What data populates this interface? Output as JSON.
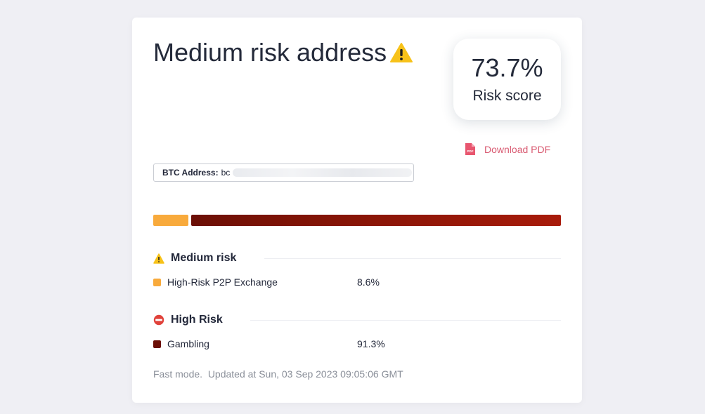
{
  "header": {
    "title": "Medium risk address",
    "title_icon": "warning-icon"
  },
  "score": {
    "value": "73.7%",
    "label": "Risk score"
  },
  "pdf": {
    "label": "Download PDF",
    "icon": "pdf-file-icon",
    "color": "#d95b72"
  },
  "address": {
    "label": "BTC Address:",
    "value": "bc"
  },
  "risk_bar": {
    "segments": [
      {
        "name": "High-Risk P2P Exchange",
        "fraction": 0.086,
        "color": "#f8aa3c"
      },
      {
        "name": "Gambling",
        "fraction": 0.913,
        "color": "#8a1507"
      }
    ]
  },
  "sections": [
    {
      "heading": "Medium risk",
      "icon": "warning-icon",
      "items": [
        {
          "name": "High-Risk P2P Exchange",
          "percent": "8.6%",
          "color": "#f8aa3c"
        }
      ]
    },
    {
      "heading": "High Risk",
      "icon": "no-entry-icon",
      "items": [
        {
          "name": "Gambling",
          "percent": "91.3%",
          "color": "#6b0f06"
        }
      ]
    }
  ],
  "footer": {
    "mode": "Fast mode.",
    "updated": "Updated at Sun, 03 Sep 2023 09:05:06 GMT"
  }
}
